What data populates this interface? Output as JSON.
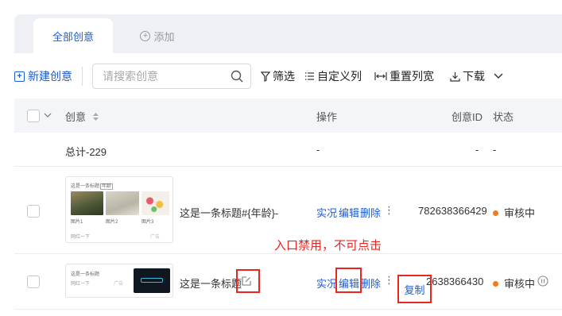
{
  "tabs": {
    "active": "全部创意",
    "add": "添加"
  },
  "toolbar": {
    "new_label": "新建创意",
    "search_placeholder": "请搜索创意",
    "filter": "筛选",
    "custom_columns": "自定义列",
    "reset_width": "重置列宽",
    "download": "下载"
  },
  "table": {
    "headers": {
      "creative": "创意",
      "actions": "操作",
      "id": "创意ID",
      "status": "状态"
    },
    "summary": {
      "label": "总计-229",
      "actions": "-",
      "id": "-",
      "status": "-"
    },
    "rows": [
      {
        "title": "这是一条标题#{年龄}-",
        "thumb_title": "这是一条标题",
        "thumb_highlight": "年龄",
        "thumb_captions": [
          "图片1",
          "图片2",
          "图片3"
        ],
        "thumb_footer_left": "网红一下",
        "thumb_footer_right": "广告",
        "actions": [
          "实况",
          "编辑",
          "删除"
        ],
        "id": "782638366429",
        "status": "审核中"
      },
      {
        "title": "这是一条标题",
        "thumb_title": "这是一条标题",
        "thumb_footer_left": "网红一下",
        "thumb_footer_right": "广告",
        "actions": [
          "实况",
          "编辑",
          "删除"
        ],
        "id": "2638366430",
        "status": "审核中"
      }
    ]
  },
  "annotation": {
    "text": "入口禁用，不可点击",
    "copy_label": "复制"
  },
  "colors": {
    "accent": "#1f5ccc",
    "annotation_red": "#e8251f",
    "status_dot": "#f07b1e"
  }
}
